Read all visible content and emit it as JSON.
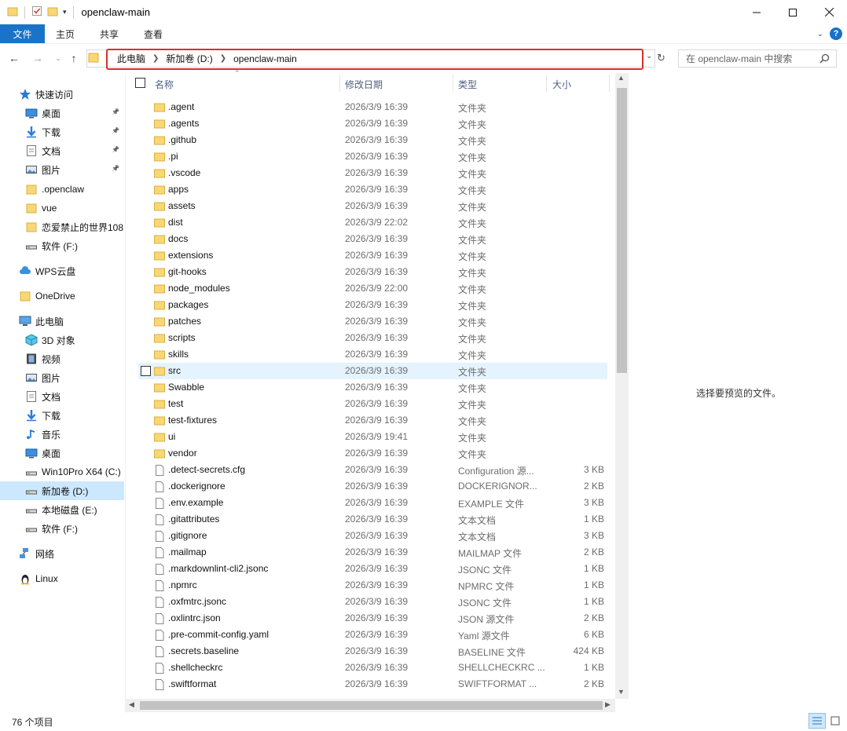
{
  "window": {
    "title": "openclaw-main"
  },
  "ribbon": {
    "tabs": [
      {
        "label": "文件"
      },
      {
        "label": "主页"
      },
      {
        "label": "共享"
      },
      {
        "label": "查看"
      }
    ]
  },
  "address": {
    "crumbs": [
      "此电脑",
      "新加卷 (D:)",
      "openclaw-main"
    ]
  },
  "search": {
    "placeholder": "在 openclaw-main 中搜索"
  },
  "sidebar": {
    "items": [
      {
        "label": "快速访问",
        "icon": "star-icon"
      },
      {
        "label": "桌面",
        "icon": "desktop-icon",
        "pinned": true
      },
      {
        "label": "下载",
        "icon": "download-icon",
        "pinned": true
      },
      {
        "label": "文档",
        "icon": "document-icon",
        "pinned": true
      },
      {
        "label": "图片",
        "icon": "picture-icon",
        "pinned": true
      },
      {
        "label": ".openclaw",
        "icon": "folder-icon"
      },
      {
        "label": "vue",
        "icon": "folder-icon"
      },
      {
        "label": "恋爱禁止的世界108",
        "icon": "folder-icon"
      },
      {
        "label": "软件 (F:)",
        "icon": "drive-icon"
      },
      {
        "label": "WPS云盘",
        "icon": "cloud-icon"
      },
      {
        "label": "OneDrive",
        "icon": "folder-icon"
      },
      {
        "label": "此电脑",
        "icon": "computer-icon"
      },
      {
        "label": "3D 对象",
        "icon": "cube-icon"
      },
      {
        "label": "视频",
        "icon": "video-icon"
      },
      {
        "label": "图片",
        "icon": "picture-icon"
      },
      {
        "label": "文档",
        "icon": "document-icon"
      },
      {
        "label": "下载",
        "icon": "download-icon"
      },
      {
        "label": "音乐",
        "icon": "music-icon"
      },
      {
        "label": "桌面",
        "icon": "desktop-icon"
      },
      {
        "label": "Win10Pro X64 (C:)",
        "icon": "drive-icon"
      },
      {
        "label": "新加卷 (D:)",
        "icon": "drive-icon",
        "selected": true
      },
      {
        "label": "本地磁盘 (E:)",
        "icon": "drive-icon"
      },
      {
        "label": "软件 (F:)",
        "icon": "drive-icon"
      },
      {
        "label": "网络",
        "icon": "network-icon"
      },
      {
        "label": "Linux",
        "icon": "linux-icon"
      }
    ]
  },
  "columns": {
    "name": "名称",
    "date": "修改日期",
    "type": "类型",
    "size": "大小"
  },
  "files": [
    {
      "name": ".agent",
      "date": "2026/3/9 16:39",
      "type": "文件夹",
      "size": "",
      "kind": "folder"
    },
    {
      "name": ".agents",
      "date": "2026/3/9 16:39",
      "type": "文件夹",
      "size": "",
      "kind": "folder"
    },
    {
      "name": ".github",
      "date": "2026/3/9 16:39",
      "type": "文件夹",
      "size": "",
      "kind": "folder"
    },
    {
      "name": ".pi",
      "date": "2026/3/9 16:39",
      "type": "文件夹",
      "size": "",
      "kind": "folder"
    },
    {
      "name": ".vscode",
      "date": "2026/3/9 16:39",
      "type": "文件夹",
      "size": "",
      "kind": "folder"
    },
    {
      "name": "apps",
      "date": "2026/3/9 16:39",
      "type": "文件夹",
      "size": "",
      "kind": "folder"
    },
    {
      "name": "assets",
      "date": "2026/3/9 16:39",
      "type": "文件夹",
      "size": "",
      "kind": "folder"
    },
    {
      "name": "dist",
      "date": "2026/3/9 22:02",
      "type": "文件夹",
      "size": "",
      "kind": "folder"
    },
    {
      "name": "docs",
      "date": "2026/3/9 16:39",
      "type": "文件夹",
      "size": "",
      "kind": "folder"
    },
    {
      "name": "extensions",
      "date": "2026/3/9 16:39",
      "type": "文件夹",
      "size": "",
      "kind": "folder"
    },
    {
      "name": "git-hooks",
      "date": "2026/3/9 16:39",
      "type": "文件夹",
      "size": "",
      "kind": "folder"
    },
    {
      "name": "node_modules",
      "date": "2026/3/9 22:00",
      "type": "文件夹",
      "size": "",
      "kind": "folder"
    },
    {
      "name": "packages",
      "date": "2026/3/9 16:39",
      "type": "文件夹",
      "size": "",
      "kind": "folder"
    },
    {
      "name": "patches",
      "date": "2026/3/9 16:39",
      "type": "文件夹",
      "size": "",
      "kind": "folder"
    },
    {
      "name": "scripts",
      "date": "2026/3/9 16:39",
      "type": "文件夹",
      "size": "",
      "kind": "folder"
    },
    {
      "name": "skills",
      "date": "2026/3/9 16:39",
      "type": "文件夹",
      "size": "",
      "kind": "folder"
    },
    {
      "name": "src",
      "date": "2026/3/9 16:39",
      "type": "文件夹",
      "size": "",
      "kind": "folder",
      "hover": true
    },
    {
      "name": "Swabble",
      "date": "2026/3/9 16:39",
      "type": "文件夹",
      "size": "",
      "kind": "folder"
    },
    {
      "name": "test",
      "date": "2026/3/9 16:39",
      "type": "文件夹",
      "size": "",
      "kind": "folder"
    },
    {
      "name": "test-fixtures",
      "date": "2026/3/9 16:39",
      "type": "文件夹",
      "size": "",
      "kind": "folder"
    },
    {
      "name": "ui",
      "date": "2026/3/9 19:41",
      "type": "文件夹",
      "size": "",
      "kind": "folder"
    },
    {
      "name": "vendor",
      "date": "2026/3/9 16:39",
      "type": "文件夹",
      "size": "",
      "kind": "folder"
    },
    {
      "name": ".detect-secrets.cfg",
      "date": "2026/3/9 16:39",
      "type": "Configuration 源...",
      "size": "3 KB",
      "kind": "file"
    },
    {
      "name": ".dockerignore",
      "date": "2026/3/9 16:39",
      "type": "DOCKERIGNOR...",
      "size": "2 KB",
      "kind": "file"
    },
    {
      "name": ".env.example",
      "date": "2026/3/9 16:39",
      "type": "EXAMPLE 文件",
      "size": "3 KB",
      "kind": "file"
    },
    {
      "name": ".gitattributes",
      "date": "2026/3/9 16:39",
      "type": "文本文档",
      "size": "1 KB",
      "kind": "file"
    },
    {
      "name": ".gitignore",
      "date": "2026/3/9 16:39",
      "type": "文本文档",
      "size": "3 KB",
      "kind": "file"
    },
    {
      "name": ".mailmap",
      "date": "2026/3/9 16:39",
      "type": "MAILMAP 文件",
      "size": "2 KB",
      "kind": "file"
    },
    {
      "name": ".markdownlint-cli2.jsonc",
      "date": "2026/3/9 16:39",
      "type": "JSONC 文件",
      "size": "1 KB",
      "kind": "file"
    },
    {
      "name": ".npmrc",
      "date": "2026/3/9 16:39",
      "type": "NPMRC 文件",
      "size": "1 KB",
      "kind": "file"
    },
    {
      "name": ".oxfmtrc.jsonc",
      "date": "2026/3/9 16:39",
      "type": "JSONC 文件",
      "size": "1 KB",
      "kind": "file"
    },
    {
      "name": ".oxlintrc.json",
      "date": "2026/3/9 16:39",
      "type": "JSON 源文件",
      "size": "2 KB",
      "kind": "file"
    },
    {
      "name": ".pre-commit-config.yaml",
      "date": "2026/3/9 16:39",
      "type": "Yaml 源文件",
      "size": "6 KB",
      "kind": "file"
    },
    {
      "name": ".secrets.baseline",
      "date": "2026/3/9 16:39",
      "type": "BASELINE 文件",
      "size": "424 KB",
      "kind": "file"
    },
    {
      "name": ".shellcheckrc",
      "date": "2026/3/9 16:39",
      "type": "SHELLCHECKRC ...",
      "size": "1 KB",
      "kind": "file"
    },
    {
      "name": ".swiftformat",
      "date": "2026/3/9 16:39",
      "type": "SWIFTFORMAT ...",
      "size": "2 KB",
      "kind": "file"
    }
  ],
  "preview": {
    "message": "选择要预览的文件。"
  },
  "status": {
    "item_count": "76 个项目"
  }
}
